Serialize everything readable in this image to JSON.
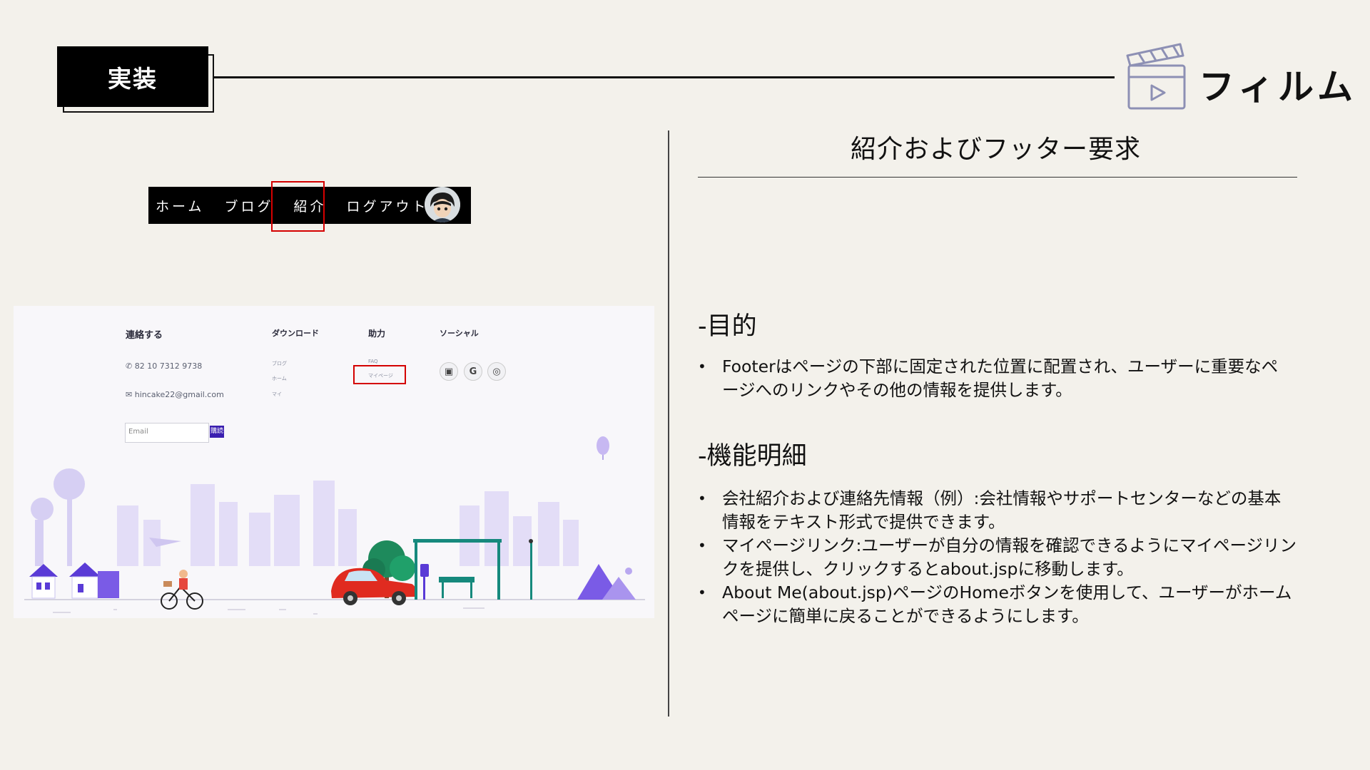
{
  "header": {
    "badge": "実装",
    "brand": "フィルム",
    "brand_icon": "clapperboard-icon"
  },
  "nav_screenshot": {
    "items": [
      "ホーム",
      "ブログ",
      "紹介",
      "ログアウト"
    ],
    "highlighted": "紹介"
  },
  "footer_screenshot": {
    "contact": {
      "heading": "連絡する",
      "phone": "82 10 7312 9738",
      "email": "hincake22@gmail.com",
      "email_placeholder": "Email",
      "subscribe": "購読"
    },
    "download": {
      "heading": "ダウンロード",
      "links": [
        "ブログ",
        "ホーム",
        "マイ"
      ]
    },
    "help": {
      "heading": "助力",
      "links": [
        "FAQ",
        "マイページ"
      ]
    },
    "social": {
      "heading": "ソーシャル"
    }
  },
  "right": {
    "title": "紹介およびフッター要求",
    "sections": [
      {
        "heading": "-目的",
        "bullets": [
          "Footerはページの下部に固定された位置に配置され、ユーザーに重要なページへのリンクやその他の情報を提供します。"
        ]
      },
      {
        "heading": "-機能明細",
        "bullets": [
          "会社紹介および連絡先情報（例）:会社情報やサポートセンターなどの基本情報をテキスト形式で提供できます。",
          "マイページリンク:ユーザーが自分の情報を確認できるようにマイページリンクを提供し、クリックするとabout.jspに移動します。",
          "About Me(about.jsp)ページのHomeボタンを使用して、ユーザーがホームページに簡単に戻ることができるようにします。"
        ]
      }
    ]
  },
  "colors": {
    "background": "#f3f1eb",
    "highlight": "#d40000",
    "accent_purple": "#3b1fb0"
  }
}
